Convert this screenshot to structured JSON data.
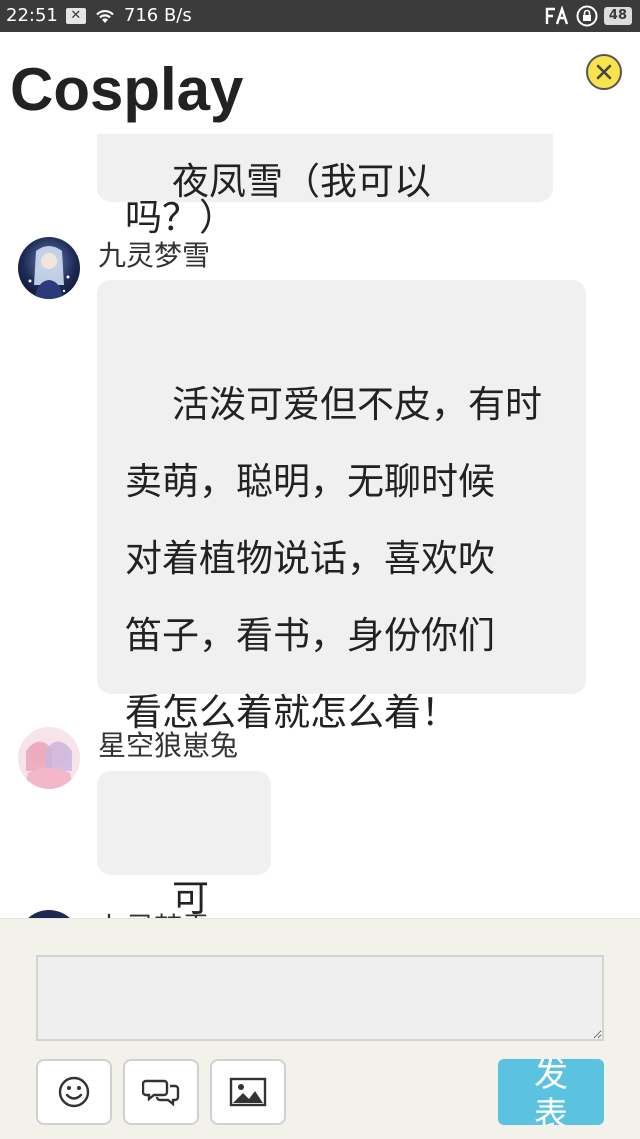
{
  "status_bar": {
    "time": "22:51",
    "network_speed": "716 B/s",
    "battery": "48",
    "icons": [
      "close-box-icon",
      "wifi-icon",
      "fa-icon",
      "lock-icon",
      "battery-icon"
    ]
  },
  "header": {
    "title": "Cosplay",
    "close_icon": "close-icon",
    "close_color": "#f7e44c"
  },
  "messages": [
    {
      "user": "",
      "text": "夜凤雪（我可以吗？）",
      "partial": true
    },
    {
      "user": "九灵梦雪",
      "avatar": "avatar-anime-girl-dark",
      "text": "活泼可爱但不皮，有时\n卖萌，聪明，无聊时候\n对着植物说话，喜欢吹\n笛子，看书，身份你们\n看怎么着就怎么着！"
    },
    {
      "user": "星空狼崽兔",
      "avatar": "avatar-anime-pair-pink",
      "text": "可以。"
    },
    {
      "user": "九灵梦雪",
      "avatar": "avatar-anime-girl-dark",
      "text": "",
      "partial": true
    }
  ],
  "composer": {
    "input_value": "",
    "input_placeholder": "",
    "emoji_icon": "smiley-icon",
    "chat_icon": "chat-bubbles-icon",
    "image_icon": "image-icon",
    "send_label": "发表",
    "send_color": "#5bc2e0"
  }
}
